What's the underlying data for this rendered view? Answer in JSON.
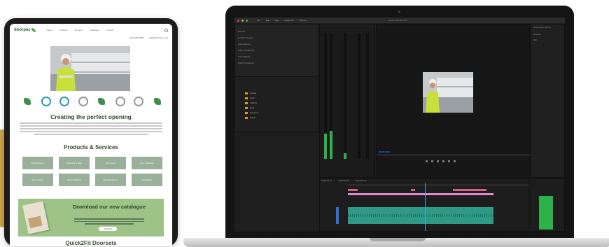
{
  "tablet": {
    "logo": "doorpac",
    "nav": [
      "Home",
      "Products",
      "Services",
      "Catalogue",
      "Contact"
    ],
    "contact_phone": "0113 256 0000",
    "contact_email": "info@doorpac.co.uk",
    "heading": "Creating the perfect opening",
    "products_heading": "Products & Services",
    "tiles": [
      "Internal Doors",
      "Door Kits & Sets",
      "Fire Doors",
      "Door Hardware",
      "Door Linings",
      "Door Finishing",
      "Bespoke Doors",
      "Installation"
    ],
    "banner_title": "Download our new catalogue",
    "banner_button": "Download",
    "bottom_heading": "Quick2Fit Doorsets"
  },
  "laptop": {
    "menu": [
      "File",
      "Edit",
      "Clip",
      "Sequence",
      "Window"
    ],
    "window_title": "Adobe Premiere Pro",
    "effects_items": [
      "Presets",
      "Lumetri Presets",
      "Audio Effects",
      "Audio Transitions",
      "Video Effects",
      "Video Transitions"
    ],
    "project_bins": [
      "Footage",
      "Audio",
      "Graphics",
      "Music",
      "Sequences",
      "Exports"
    ],
    "timecode": "00:00:12:04",
    "timeline_tabs": [
      "Sequence 01",
      "Sequence 02",
      "Sequence 03"
    ],
    "right_panel": [
      "Essential Graphics",
      "Browse",
      "Edit"
    ]
  }
}
